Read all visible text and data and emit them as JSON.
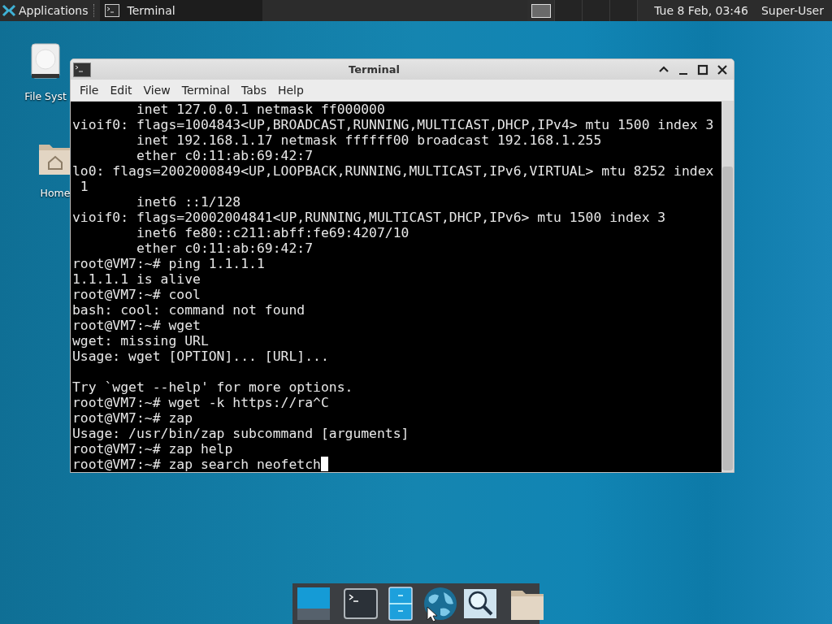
{
  "top_panel": {
    "app_menu": {
      "label": "Applications"
    },
    "tasks": [
      {
        "label": "Terminal",
        "selected": true
      }
    ],
    "workspaces": [
      {
        "selected": true
      },
      {
        "selected": false
      },
      {
        "selected": false
      },
      {
        "selected": false
      }
    ],
    "clock": "Tue  8 Feb, 03:46",
    "user": "Super-User"
  },
  "desktop_icons": [
    {
      "kind": "drive",
      "label": "File Syst"
    },
    {
      "kind": "home",
      "label": "Home"
    }
  ],
  "window": {
    "title": "Terminal",
    "menu": [
      "File",
      "Edit",
      "View",
      "Terminal",
      "Tabs",
      "Help"
    ],
    "lines": [
      {
        "kind": "text",
        "text": "        inet 127.0.0.1 netmask ff000000"
      },
      {
        "kind": "text",
        "text": "vioif0: flags=1004843<UP,BROADCAST,RUNNING,MULTICAST,DHCP,IPv4> mtu 1500 index 3"
      },
      {
        "kind": "text",
        "text": "        inet 192.168.1.17 netmask ffffff00 broadcast 192.168.1.255"
      },
      {
        "kind": "text",
        "text": "        ether c0:11:ab:69:42:7"
      },
      {
        "kind": "text",
        "text": "lo0: flags=2002000849<UP,LOOPBACK,RUNNING,MULTICAST,IPv6,VIRTUAL> mtu 8252 index"
      },
      {
        "kind": "text",
        "text": " 1"
      },
      {
        "kind": "text",
        "text": "        inet6 ::1/128"
      },
      {
        "kind": "text",
        "text": "vioif0: flags=20002004841<UP,RUNNING,MULTICAST,DHCP,IPv6> mtu 1500 index 3"
      },
      {
        "kind": "text",
        "text": "        inet6 fe80::c211:abff:fe69:4207/10"
      },
      {
        "kind": "text",
        "text": "        ether c0:11:ab:69:42:7"
      },
      {
        "kind": "text",
        "text": "root@VM7:~# ping 1.1.1.1"
      },
      {
        "kind": "text",
        "text": "1.1.1.1 is alive"
      },
      {
        "kind": "text",
        "text": "root@VM7:~# cool"
      },
      {
        "kind": "text",
        "text": "bash: cool: command not found"
      },
      {
        "kind": "text",
        "text": "root@VM7:~# wget"
      },
      {
        "kind": "text",
        "text": "wget: missing URL"
      },
      {
        "kind": "text",
        "text": "Usage: wget [OPTION]... [URL]..."
      },
      {
        "kind": "blank"
      },
      {
        "kind": "text",
        "text": "Try `wget --help' for more options."
      },
      {
        "kind": "text",
        "text": "root@VM7:~# wget -k https://ra^C"
      },
      {
        "kind": "text",
        "text": "root@VM7:~# zap"
      },
      {
        "kind": "text",
        "text": "Usage: /usr/bin/zap subcommand [arguments]"
      },
      {
        "kind": "text",
        "text": "root@VM7:~# zap help"
      },
      {
        "kind": "text",
        "text": "root@VM7:~# zap search neofetch"
      }
    ]
  },
  "dock": [
    {
      "kind": "show-desktop"
    },
    {
      "kind": "separator"
    },
    {
      "kind": "terminal"
    },
    {
      "kind": "files"
    },
    {
      "kind": "browser"
    },
    {
      "kind": "search"
    },
    {
      "kind": "separator"
    },
    {
      "kind": "folder"
    }
  ]
}
